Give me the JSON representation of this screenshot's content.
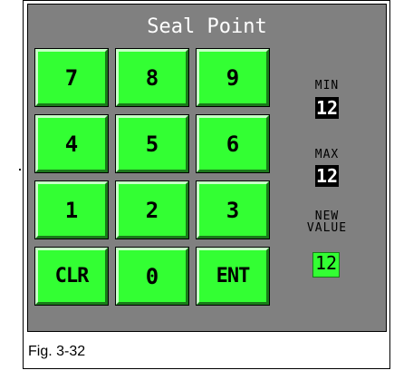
{
  "screen": {
    "title": "Seal Point"
  },
  "keypad": {
    "keys": [
      "7",
      "8",
      "9",
      "4",
      "5",
      "6",
      "1",
      "2",
      "3",
      "CLR",
      "0",
      "ENT"
    ]
  },
  "limits": {
    "min_label": "MIN",
    "min_value": "12",
    "max_label": "MAX",
    "max_value": "12",
    "new_label_line1": "NEW",
    "new_label_line2": "VALUE",
    "new_value": "12"
  },
  "caption": {
    "text": "Fig. 3-32"
  },
  "colors": {
    "panel": "#808080",
    "key": "#33ff33",
    "value_box": "#000000",
    "new_value_box": "#33ff33"
  }
}
